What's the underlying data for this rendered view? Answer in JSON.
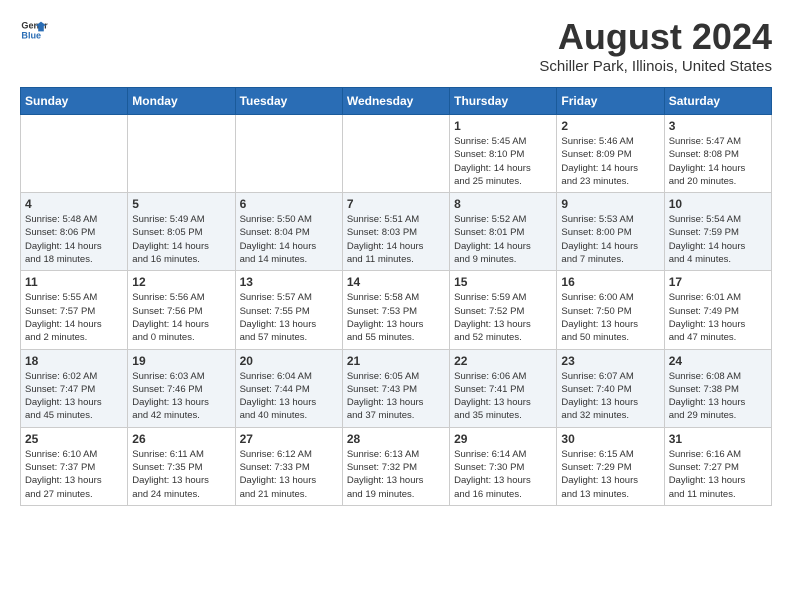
{
  "logo": {
    "general": "General",
    "blue": "Blue"
  },
  "title": "August 2024",
  "location": "Schiller Park, Illinois, United States",
  "weekdays": [
    "Sunday",
    "Monday",
    "Tuesday",
    "Wednesday",
    "Thursday",
    "Friday",
    "Saturday"
  ],
  "weeks": [
    [
      {
        "day": "",
        "info": ""
      },
      {
        "day": "",
        "info": ""
      },
      {
        "day": "",
        "info": ""
      },
      {
        "day": "",
        "info": ""
      },
      {
        "day": "1",
        "info": "Sunrise: 5:45 AM\nSunset: 8:10 PM\nDaylight: 14 hours\nand 25 minutes."
      },
      {
        "day": "2",
        "info": "Sunrise: 5:46 AM\nSunset: 8:09 PM\nDaylight: 14 hours\nand 23 minutes."
      },
      {
        "day": "3",
        "info": "Sunrise: 5:47 AM\nSunset: 8:08 PM\nDaylight: 14 hours\nand 20 minutes."
      }
    ],
    [
      {
        "day": "4",
        "info": "Sunrise: 5:48 AM\nSunset: 8:06 PM\nDaylight: 14 hours\nand 18 minutes."
      },
      {
        "day": "5",
        "info": "Sunrise: 5:49 AM\nSunset: 8:05 PM\nDaylight: 14 hours\nand 16 minutes."
      },
      {
        "day": "6",
        "info": "Sunrise: 5:50 AM\nSunset: 8:04 PM\nDaylight: 14 hours\nand 14 minutes."
      },
      {
        "day": "7",
        "info": "Sunrise: 5:51 AM\nSunset: 8:03 PM\nDaylight: 14 hours\nand 11 minutes."
      },
      {
        "day": "8",
        "info": "Sunrise: 5:52 AM\nSunset: 8:01 PM\nDaylight: 14 hours\nand 9 minutes."
      },
      {
        "day": "9",
        "info": "Sunrise: 5:53 AM\nSunset: 8:00 PM\nDaylight: 14 hours\nand 7 minutes."
      },
      {
        "day": "10",
        "info": "Sunrise: 5:54 AM\nSunset: 7:59 PM\nDaylight: 14 hours\nand 4 minutes."
      }
    ],
    [
      {
        "day": "11",
        "info": "Sunrise: 5:55 AM\nSunset: 7:57 PM\nDaylight: 14 hours\nand 2 minutes."
      },
      {
        "day": "12",
        "info": "Sunrise: 5:56 AM\nSunset: 7:56 PM\nDaylight: 14 hours\nand 0 minutes."
      },
      {
        "day": "13",
        "info": "Sunrise: 5:57 AM\nSunset: 7:55 PM\nDaylight: 13 hours\nand 57 minutes."
      },
      {
        "day": "14",
        "info": "Sunrise: 5:58 AM\nSunset: 7:53 PM\nDaylight: 13 hours\nand 55 minutes."
      },
      {
        "day": "15",
        "info": "Sunrise: 5:59 AM\nSunset: 7:52 PM\nDaylight: 13 hours\nand 52 minutes."
      },
      {
        "day": "16",
        "info": "Sunrise: 6:00 AM\nSunset: 7:50 PM\nDaylight: 13 hours\nand 50 minutes."
      },
      {
        "day": "17",
        "info": "Sunrise: 6:01 AM\nSunset: 7:49 PM\nDaylight: 13 hours\nand 47 minutes."
      }
    ],
    [
      {
        "day": "18",
        "info": "Sunrise: 6:02 AM\nSunset: 7:47 PM\nDaylight: 13 hours\nand 45 minutes."
      },
      {
        "day": "19",
        "info": "Sunrise: 6:03 AM\nSunset: 7:46 PM\nDaylight: 13 hours\nand 42 minutes."
      },
      {
        "day": "20",
        "info": "Sunrise: 6:04 AM\nSunset: 7:44 PM\nDaylight: 13 hours\nand 40 minutes."
      },
      {
        "day": "21",
        "info": "Sunrise: 6:05 AM\nSunset: 7:43 PM\nDaylight: 13 hours\nand 37 minutes."
      },
      {
        "day": "22",
        "info": "Sunrise: 6:06 AM\nSunset: 7:41 PM\nDaylight: 13 hours\nand 35 minutes."
      },
      {
        "day": "23",
        "info": "Sunrise: 6:07 AM\nSunset: 7:40 PM\nDaylight: 13 hours\nand 32 minutes."
      },
      {
        "day": "24",
        "info": "Sunrise: 6:08 AM\nSunset: 7:38 PM\nDaylight: 13 hours\nand 29 minutes."
      }
    ],
    [
      {
        "day": "25",
        "info": "Sunrise: 6:10 AM\nSunset: 7:37 PM\nDaylight: 13 hours\nand 27 minutes."
      },
      {
        "day": "26",
        "info": "Sunrise: 6:11 AM\nSunset: 7:35 PM\nDaylight: 13 hours\nand 24 minutes."
      },
      {
        "day": "27",
        "info": "Sunrise: 6:12 AM\nSunset: 7:33 PM\nDaylight: 13 hours\nand 21 minutes."
      },
      {
        "day": "28",
        "info": "Sunrise: 6:13 AM\nSunset: 7:32 PM\nDaylight: 13 hours\nand 19 minutes."
      },
      {
        "day": "29",
        "info": "Sunrise: 6:14 AM\nSunset: 7:30 PM\nDaylight: 13 hours\nand 16 minutes."
      },
      {
        "day": "30",
        "info": "Sunrise: 6:15 AM\nSunset: 7:29 PM\nDaylight: 13 hours\nand 13 minutes."
      },
      {
        "day": "31",
        "info": "Sunrise: 6:16 AM\nSunset: 7:27 PM\nDaylight: 13 hours\nand 11 minutes."
      }
    ]
  ]
}
